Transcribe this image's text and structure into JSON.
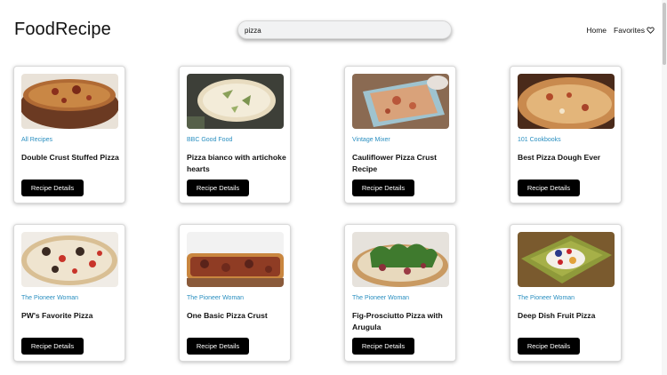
{
  "header": {
    "logo": "FoodRecipe",
    "search": {
      "value": "pizza",
      "placeholder": ""
    },
    "nav": {
      "home": "Home",
      "favorites": "Favorites"
    }
  },
  "colors": {
    "accent_link": "#2a8fc0",
    "button_bg": "#000000"
  },
  "recipes": [
    {
      "source": "All Recipes",
      "title": "Double Crust Stuffed Pizza",
      "button": "Recipe Details",
      "image": "double-crust-pizza-photo"
    },
    {
      "source": "BBC Good Food",
      "title": "Pizza bianco with artichoke hearts",
      "button": "Recipe Details",
      "image": "pizza-bianco-photo"
    },
    {
      "source": "Vintage Mixer",
      "title": "Cauliflower Pizza Crust Recipe",
      "button": "Recipe Details",
      "image": "cauliflower-pizza-photo"
    },
    {
      "source": "101 Cookbooks",
      "title": "Best Pizza Dough Ever",
      "button": "Recipe Details",
      "image": "pizza-dough-photo"
    },
    {
      "source": "The Pioneer Woman",
      "title": "PW's Favorite Pizza",
      "button": "Recipe Details",
      "image": "pw-favorite-pizza-photo"
    },
    {
      "source": "The Pioneer Woman",
      "title": "One Basic Pizza Crust",
      "button": "Recipe Details",
      "image": "basic-pizza-crust-photo"
    },
    {
      "source": "The Pioneer Woman",
      "title": "Fig-Prosciutto Pizza with Arugula",
      "button": "Recipe Details",
      "image": "fig-prosciutto-pizza-photo"
    },
    {
      "source": "The Pioneer Woman",
      "title": "Deep Dish Fruit Pizza",
      "button": "Recipe Details",
      "image": "fruit-pizza-photo"
    }
  ]
}
